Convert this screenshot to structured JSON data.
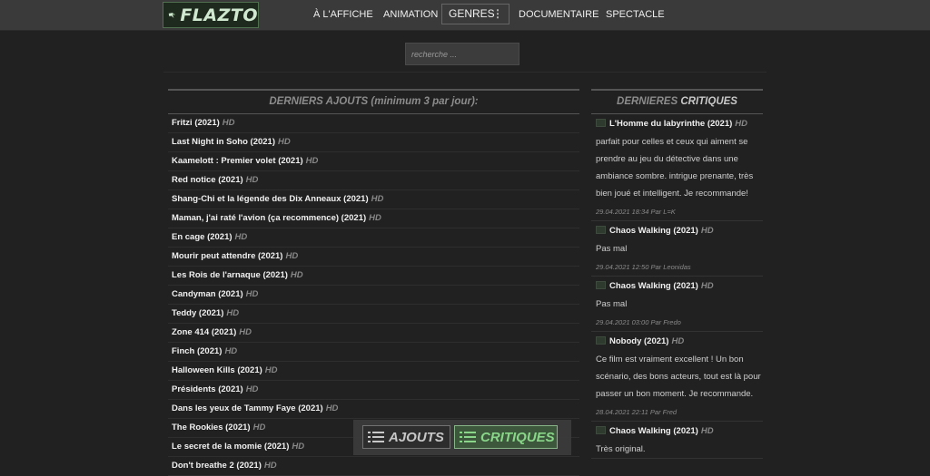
{
  "brand": {
    "name": "FLAZTO"
  },
  "nav": {
    "items": [
      "À L'AFFICHE",
      "ANIMATION",
      "GENRES",
      "DOCUMENTAIRE",
      "SPECTACLE"
    ]
  },
  "search": {
    "placeholder": "recherche ..."
  },
  "latest": {
    "heading": "DERNIERS AJOUTS (minimum 3 par jour):",
    "quality_tag": "HD",
    "items": [
      "Fritzi (2021)",
      "Last Night in Soho (2021)",
      "Kaamelott : Premier volet (2021)",
      "Red notice (2021)",
      "Shang-Chi et la légende des Dix Anneaux (2021)",
      "Maman, j'ai raté l'avion (ça recommence) (2021)",
      "En cage (2021)",
      "Mourir peut attendre (2021)",
      "Les Rois de l'arnaque (2021)",
      "Candyman (2021)",
      "Teddy (2021)",
      "Zone 414 (2021)",
      "Finch (2021)",
      "Halloween Kills (2021)",
      "Présidents (2021)",
      "Dans les yeux de Tammy Faye (2021)",
      "The Rookies (2021)",
      "Le secret de la momie (2021)",
      "Don't breathe 2 (2021)"
    ]
  },
  "reviews": {
    "heading_prefix": "DERNIERES",
    "heading_strong": "CRITIQUES",
    "quality_tag": "HD",
    "items": [
      {
        "title": "L'Homme du labyrinthe (2021)",
        "text": "parfait pour celles et ceux qui aiment se prendre au jeu du détective dans une ambiance sombre. intrigue prenante, très bien joué et intelligent. Je recommande!",
        "meta": "29.04.2021 18:34 Par L=K"
      },
      {
        "title": "Chaos Walking (2021)",
        "text": "Pas mal",
        "meta": "29.04.2021 12:50 Par Leonidas"
      },
      {
        "title": "Chaos Walking (2021)",
        "text": "Pas mal",
        "meta": "29.04.2021 03:00 Par Fredo"
      },
      {
        "title": "Nobody (2021)",
        "text": "Ce film est vraiment excellent ! Un bon scénario, des bons acteurs, tout est là pour passer un bon moment. Je recommande.",
        "meta": "28.04.2021 22:11 Par Fred"
      },
      {
        "title": "Chaos Walking (2021)",
        "text": "Très original.",
        "meta": ""
      }
    ]
  },
  "switcher": {
    "ajouts_label": "AJOUTS",
    "critiques_label": "CRITIQUES"
  },
  "colors": {
    "accent": "#8fe08f",
    "background": "#212121",
    "topbar": "#3a3a3a"
  }
}
